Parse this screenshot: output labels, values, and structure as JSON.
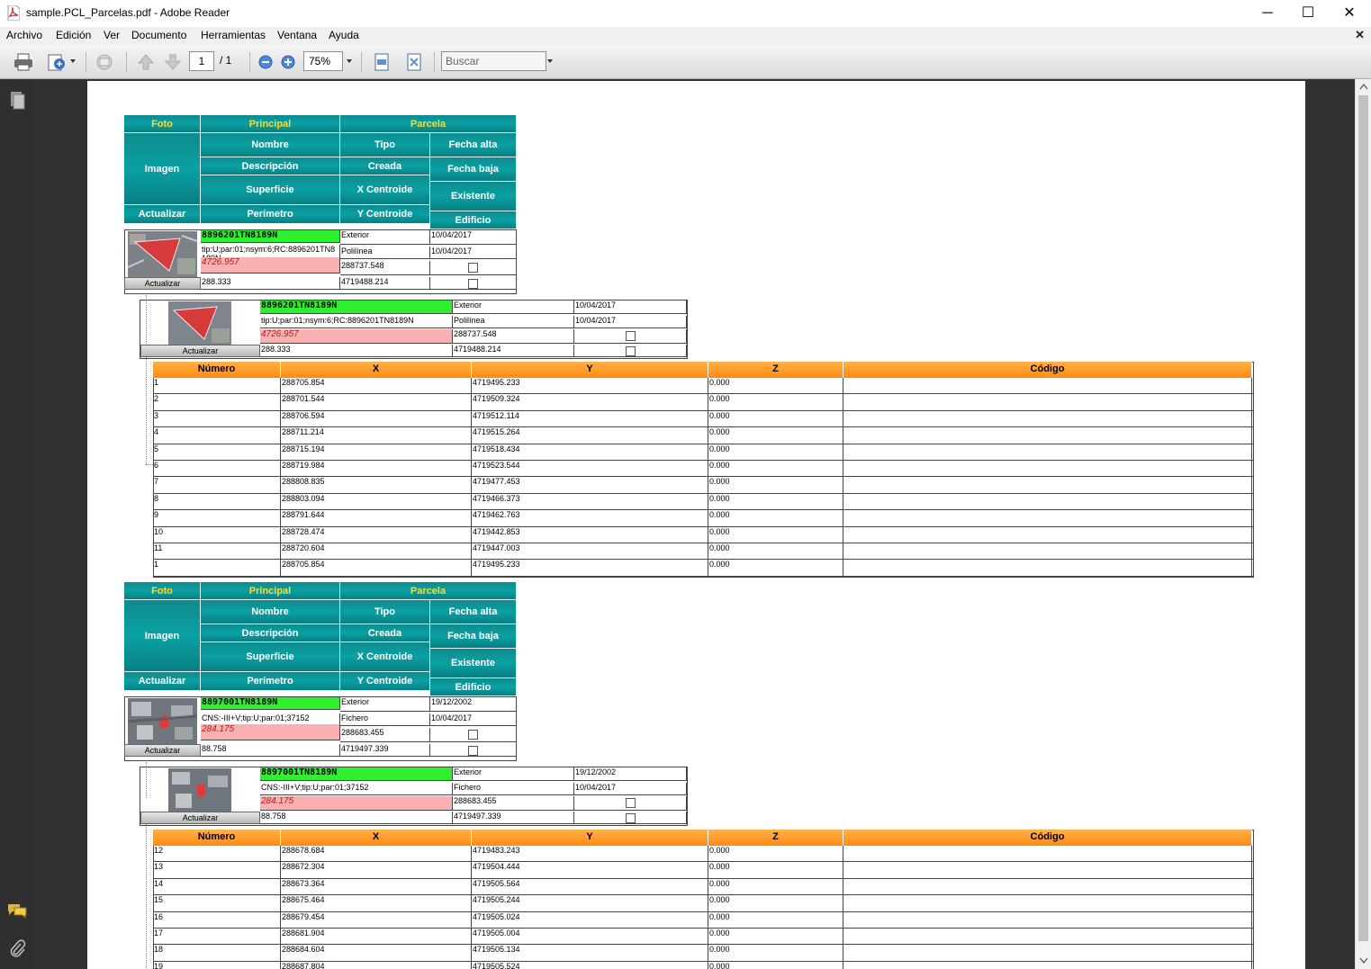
{
  "window": {
    "title": "sample.PCL_Parcelas.pdf - Adobe Reader",
    "min_glyph": "─",
    "max_glyph": "☐",
    "close_glyph": "✕"
  },
  "menu": {
    "items": [
      "Archivo",
      "Edición",
      "Ver",
      "Documento",
      "Herramientas",
      "Ventana",
      "Ayuda"
    ],
    "close_glyph": "✕"
  },
  "toolbar": {
    "page_current": "1",
    "page_total": "/ 1",
    "zoom": "75%",
    "search_placeholder": "Buscar"
  },
  "headers": {
    "foto": "Foto",
    "principal": "Principal",
    "parcela": "Parcela",
    "imagen": "Imagen",
    "nombre": "Nombre",
    "tipo": "Tipo",
    "fecha_alta": "Fecha alta",
    "descripcion": "Descripción",
    "creada": "Creada",
    "fecha_baja": "Fecha baja",
    "superficie": "Superficie",
    "x_centroide": "X Centroide",
    "existente": "Existente",
    "actualizar": "Actualizar",
    "perimetro": "Perímetro",
    "y_centroide": "Y Centroide",
    "edificio": "Edificio"
  },
  "vertex_columns": [
    "Número",
    "X",
    "Y",
    "Z",
    "Código"
  ],
  "parcels": [
    {
      "nombre": "8896201TN8189N",
      "descripcion": "tip:U;par:01;nsym:6;RC:8896201TN",
      "descripcion_wrap": "8189N",
      "superficie": "4726.957",
      "perimetro": "288.333",
      "tipo": "Exterior",
      "creada": "Polilínea",
      "x_centroide": "288737.548",
      "y_centroide": "4719488.214",
      "fecha_alta": "10/04/2017",
      "fecha_baja": "10/04/2017",
      "sub_descripcion": "tip:U;par:01;nsym:6;RC:8896201TN8189N",
      "actualizar": "Actualizar",
      "vertices": [
        [
          "1",
          "288705.854",
          "4719495.233",
          "0.000",
          ""
        ],
        [
          "2",
          "288701.544",
          "4719509.324",
          "0.000",
          ""
        ],
        [
          "3",
          "288706.594",
          "4719512.114",
          "0.000",
          ""
        ],
        [
          "4",
          "288711.214",
          "4719515.264",
          "0.000",
          ""
        ],
        [
          "5",
          "288715.194",
          "4719518.434",
          "0.000",
          ""
        ],
        [
          "6",
          "288719.984",
          "4719523.544",
          "0.000",
          ""
        ],
        [
          "7",
          "288808.835",
          "4719477.453",
          "0.000",
          ""
        ],
        [
          "8",
          "288803.094",
          "4719466.373",
          "0.000",
          ""
        ],
        [
          "9",
          "288791.644",
          "4719462.763",
          "0.000",
          ""
        ],
        [
          "10",
          "288728.474",
          "4719442.853",
          "0.000",
          ""
        ],
        [
          "11",
          "288720.604",
          "4719447.003",
          "0.000",
          ""
        ],
        [
          "1",
          "288705.854",
          "4719495.233",
          "0.000",
          ""
        ]
      ]
    },
    {
      "nombre": "8897001TN8189N",
      "descripcion": "CNS:-III+V;tip:U;par:01;37152",
      "descripcion_wrap": "",
      "superficie": "284.175",
      "perimetro": "88.758",
      "tipo": "Exterior",
      "creada": "Fichero",
      "x_centroide": "288683.455",
      "y_centroide": "4719497.339",
      "fecha_alta": "19/12/2002",
      "fecha_baja": "10/04/2017",
      "sub_descripcion": "CNS:-III+V;tip:U;par:01;37152",
      "actualizar": "Actualizar",
      "vertices": [
        [
          "12",
          "288678.684",
          "4719483.243",
          "0.000",
          ""
        ],
        [
          "13",
          "288672.304",
          "4719504.444",
          "0.000",
          ""
        ],
        [
          "14",
          "288673.364",
          "4719505.564",
          "0.000",
          ""
        ],
        [
          "15",
          "288675.464",
          "4719505.244",
          "0.000",
          ""
        ],
        [
          "16",
          "288679.454",
          "4719505.024",
          "0.000",
          ""
        ],
        [
          "17",
          "288681.904",
          "4719505.004",
          "0.000",
          ""
        ],
        [
          "18",
          "288684.604",
          "4719505.134",
          "0.000",
          ""
        ],
        [
          "19",
          "288687.804",
          "4719505.524",
          "0.000",
          ""
        ]
      ]
    }
  ],
  "colors": {
    "teal_header": "#0aa1a4",
    "yellow_header_text": "#ffd92e",
    "orange_header": "#ff8a10",
    "green_name": "#2ff02f",
    "pink_area": "#f8b0b0"
  }
}
